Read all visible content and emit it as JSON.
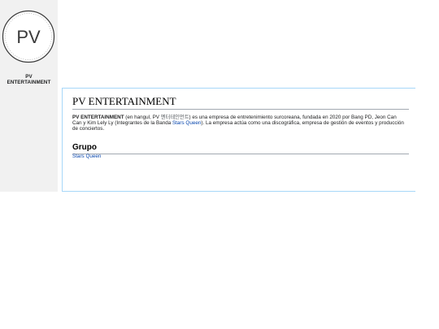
{
  "sidebar": {
    "logo": {
      "text": "PV",
      "icon": "circular-logo-icon"
    },
    "site_name_line1": "PV",
    "site_name_line2": "ENTERTAINMENT"
  },
  "article": {
    "title": "PV ENTERTAINMENT",
    "intro": {
      "subject": "PV ENTERTAINMENT",
      "text_1": " (en hangul, PV ",
      "hangul": "엔터테인먼트",
      "text_2": ") es una empresa de entretenimiento surcoreana, fundada en 2020 por Bang PD, Jeon Can Can y Kim Lely Ly (Integrantes de la Banda ",
      "link": "Stars Queen",
      "text_3": "). La empresa actúa como una discográfica, empresa de gestión de eventos y producción de conciertos."
    },
    "sections": [
      {
        "heading": "Grupo",
        "items": [
          "Stars Queen"
        ]
      }
    ]
  },
  "colors": {
    "link": "#0645ad",
    "sidebar_bg": "#f1f1f1",
    "content_border": "#a7d7f9",
    "divider": "#a2a9b1"
  }
}
